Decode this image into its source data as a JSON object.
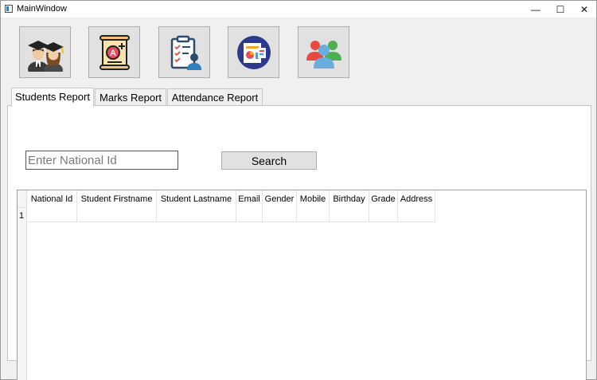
{
  "window": {
    "title": "MainWindow",
    "controls": {
      "minimize": "—",
      "maximize": "☐",
      "close": "✕"
    }
  },
  "toolbar": {
    "buttons": [
      {
        "icon": "graduates-icon"
      },
      {
        "icon": "grade-certificate-icon"
      },
      {
        "icon": "attendance-clipboard-icon"
      },
      {
        "icon": "report-chart-icon"
      },
      {
        "icon": "users-group-icon"
      }
    ]
  },
  "tabs": [
    {
      "label": "Students Report",
      "active": true
    },
    {
      "label": "Marks Report",
      "active": false
    },
    {
      "label": "Attendance Report",
      "active": false
    }
  ],
  "search": {
    "placeholder": "Enter National Id",
    "value": "",
    "button_label": "Search"
  },
  "table": {
    "columns": [
      "National Id",
      "Student Firstname",
      "Student Lastname",
      "Email",
      "Gender",
      "Mobile",
      "Birthday",
      "Grade",
      "Address"
    ],
    "row_numbers": [
      "1"
    ]
  }
}
